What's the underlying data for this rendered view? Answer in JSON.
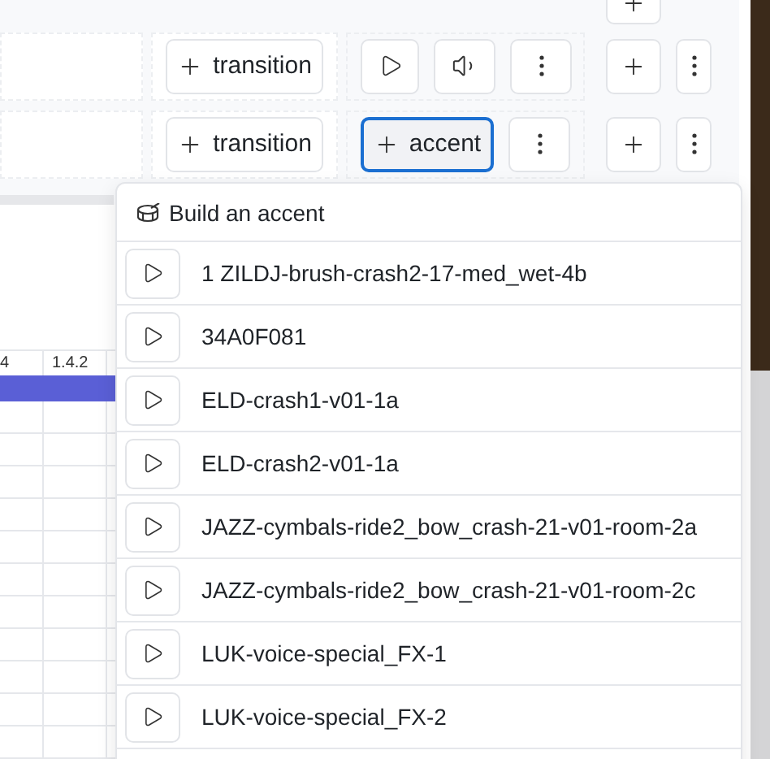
{
  "lanes": [
    {
      "kind": "playback",
      "transition_label": "transition"
    },
    {
      "kind": "accent",
      "transition_label": "transition",
      "accent_label": "accent",
      "accent_open": true
    }
  ],
  "grid": {
    "header": [
      "4",
      "1.4.2"
    ]
  },
  "accent_menu": {
    "title": "Build an accent",
    "items": [
      "1 ZILDJ-brush-crash2-17-med_wet-4b",
      "34A0F081",
      "ELD-crash1-v01-1a",
      "ELD-crash2-v01-1a",
      "JAZZ-cymbals-ride2_bow_crash-21-v01-room-2a",
      "JAZZ-cymbals-ride2_bow_crash-21-v01-room-2c",
      "LUK-voice-special_FX-1",
      "LUK-voice-special_FX-2"
    ]
  }
}
